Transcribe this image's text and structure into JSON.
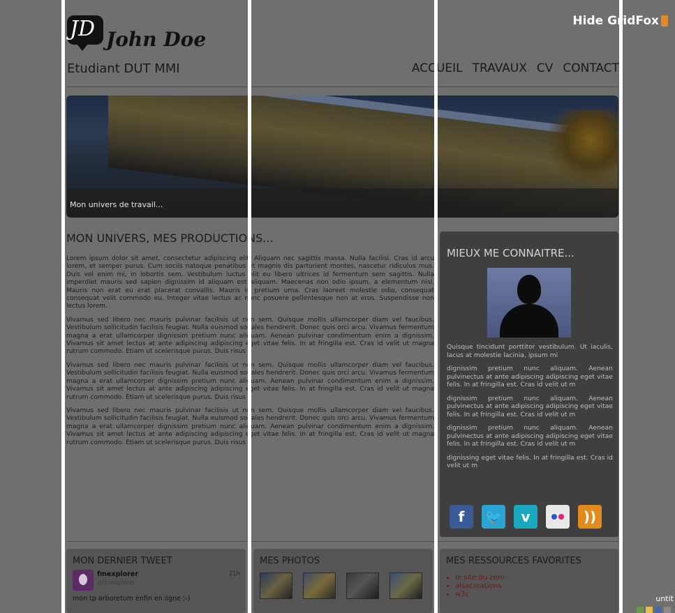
{
  "header": {
    "logo_initials": "JD",
    "name": "John Doe",
    "subtitle": "Etudiant DUT MMI",
    "nav": [
      "ACCUEIL",
      "TRAVAUX",
      "CV",
      "CONTACT"
    ]
  },
  "hero": {
    "caption": "Mon univers de travail..."
  },
  "main": {
    "title": "MON UNIVERS, MES PRODUCTIONS...",
    "paragraphs": [
      "Lorem ipsum dolor sit amet, consectetur adipiscing elit. Aliquam nec sagittis massa. Nulla facilisi. Cras id arcu lorem, et semper purus. Cum sociis natoque penatibus et magnis dis parturient montes, nascetur ridiculus mus. Duis vel enim mi, in lobortis sem. Vestibulum luctus elit eu libero ultrices id fermentum sem sagittis. Nulla imperdiet mauris sed sapien dignissim id aliquam est aliquam. Maecenas non odio ipsum, a elementum nisi. Mauris non erat eu erat placerat convallis. Mauris in pretium urna. Cras laoreet molestie odio, consequat consequat velit commodo eu. Integer vitae lectus ac nunc posuere pellentesque non at eros. Suspendisse non lectus lorem.",
      "Vivamus sed libero nec mauris pulvinar facilisis ut non sem. Quisque mollis ullamcorper diam vel faucibus. Vestibulum sollicitudin facilisis feugiat. Nulla euismod sodales hendrerit. Donec quis orci arcu. Vivamus fermentum magna a erat ullamcorper dignissim pretium nunc aliquam. Aenean pulvinar condimentum enim a dignissim. Vivamus sit amet lectus at ante adipiscing adipiscing eget vitae felis. In at fringilla est. Cras id velit ut magna rutrum commodo. Etiam ut scelerisque purus. Duis risus",
      "Vivamus sed libero nec mauris pulvinar facilisis ut non sem. Quisque mollis ullamcorper diam vel faucibus. Vestibulum sollicitudin facilisis feugiat. Nulla euismod sodales hendrerit. Donec quis orci arcu. Vivamus fermentum magna a erat ullamcorper dignissim pretium nunc aliquam. Aenean pulvinar condimentum enim a dignissim. Vivamus sit amet lectus at ante adipiscing adipiscing eget vitae felis. In at fringilla est. Cras id velit ut magna rutrum commodo. Etiam ut scelerisque purus. Duis risus",
      "Vivamus sed libero nec mauris pulvinar facilisis ut non sem. Quisque mollis ullamcorper diam vel faucibus. Vestibulum sollicitudin facilisis feugiat. Nulla euismod sodales hendrerit. Donec quis orci arcu. Vivamus fermentum magna a erat ullamcorper dignissim pretium nunc aliquam. Aenean pulvinar condimentum enim a dignissim. Vivamus sit amet lectus at ante adipiscing adipiscing eget vitae felis. In at fringilla est. Cras id velit ut magna rutrum commodo. Etiam ut scelerisque purus. Duis risus"
    ]
  },
  "sidebar": {
    "title": "MIEUX ME CONNAITRE...",
    "texts": [
      "Quisque tincidunt porttitor vestibulum. Ut iaculis, lacus at molestie lacinia, ipsum mi",
      "dignissim pretium nunc aliquam. Aenean pulvinectus at ante adipiscing adipiscing eget vitae felis. In at fringilla est. Cras id velit ut m",
      "dignissim pretium nunc aliquam. Aenean pulvinectus at ante adipiscing adipiscing eget vitae felis. In at fringilla est. Cras id velit ut m",
      "dignissim pretium nunc aliquam. Aenean pulvinectus at ante adipiscing adipiscing eget vitae felis. In at fringilla est. Cras id velit ut m",
      "dignissing eget vitae felis. In at fringilla est. Cras id velit ut m"
    ],
    "socials": [
      {
        "icon": "facebook-icon",
        "glyph": "f"
      },
      {
        "icon": "twitter-icon",
        "glyph": "🐦"
      },
      {
        "icon": "vimeo-icon",
        "glyph": "v"
      },
      {
        "icon": "flickr-icon",
        "glyph": ""
      },
      {
        "icon": "rss-icon",
        "glyph": "))"
      }
    ]
  },
  "tweet_box": {
    "title": "MON DERNIER TWEET",
    "user": "fmexplorer",
    "handle": "@fmexplorer",
    "time": "21h",
    "text": "mon tp arboretum enfin en ligne ;-)"
  },
  "photos_box": {
    "title": "MES PHOTOS"
  },
  "resources_box": {
    "title": "MES RESSOURCES FAVORITES",
    "links": [
      "le site du zero",
      "alsacreations",
      "w3c"
    ]
  },
  "overlay": {
    "toggle_label": "Hide GridFox",
    "corner_text": "untit"
  },
  "colors": {
    "grid": "#ffffff",
    "link": "#6a1c14",
    "sidebar_bg": "#3f3f3f"
  }
}
